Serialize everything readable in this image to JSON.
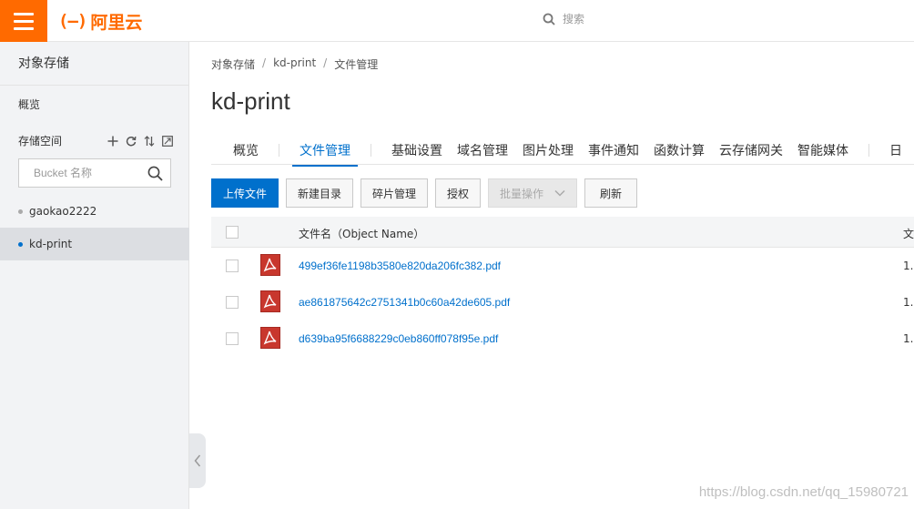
{
  "header": {
    "logo_mark": "(–)",
    "logo_text": "阿里云",
    "search_placeholder": "搜索"
  },
  "sidebar": {
    "title": "对象存储",
    "overview": "概览",
    "storage_label": "存储空间",
    "search_placeholder": "Bucket 名称",
    "buckets": [
      {
        "name": "gaokao2222",
        "active": false
      },
      {
        "name": "kd-print",
        "active": true
      }
    ]
  },
  "breadcrumb": [
    "对象存储",
    "kd-print",
    "文件管理"
  ],
  "page_title": "kd-print",
  "tabs": [
    "概览",
    "文件管理",
    "基础设置",
    "域名管理",
    "图片处理",
    "事件通知",
    "函数计算",
    "云存储网关",
    "智能媒体",
    "日"
  ],
  "active_tab": "文件管理",
  "toolbar": {
    "upload": "上传文件",
    "new_dir": "新建目录",
    "fragments": "碎片管理",
    "authorize": "授权",
    "batch": "批量操作",
    "refresh": "刷新"
  },
  "table": {
    "header_name": "文件名（Object Name）",
    "header_next": "文",
    "rows": [
      {
        "name": "499ef36fe1198b3580e820da206fc382.pdf",
        "next": "1."
      },
      {
        "name": "ae861875642c2751341b0c60a42de605.pdf",
        "next": "1."
      },
      {
        "name": "d639ba95f6688229c0eb860ff078f95e.pdf",
        "next": "1."
      }
    ]
  },
  "watermark": "https://blog.csdn.net/qq_15980721",
  "colors": {
    "brand": "#ff6a00",
    "accent": "#0070cc"
  }
}
